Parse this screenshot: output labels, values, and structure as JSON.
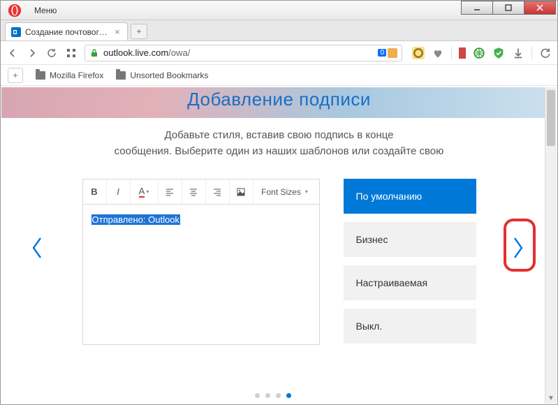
{
  "window": {
    "menu_label": "Меню",
    "tab_title": "Создание почтового ящи",
    "url_path": "/owa/",
    "url_host": "outlook.live.com",
    "url_badge": "0"
  },
  "bookmarks": {
    "firefox": "Mozilla Firefox",
    "unsorted": "Unsorted Bookmarks"
  },
  "content": {
    "heading": "Добавление подписи",
    "sub1": "Добавьте стиля, вставив свою подпись в конце",
    "sub2": "сообщения. Выберите один из наших шаблонов или создайте свою",
    "editor_text": "Отправлено: Outlook",
    "font_sizes_label": "Font Sizes"
  },
  "templates": {
    "default": "По умолчанию",
    "business": "Бизнес",
    "custom": "Настраиваемая",
    "off": "Выкл."
  },
  "pager": {
    "total": 4,
    "active": 4
  }
}
